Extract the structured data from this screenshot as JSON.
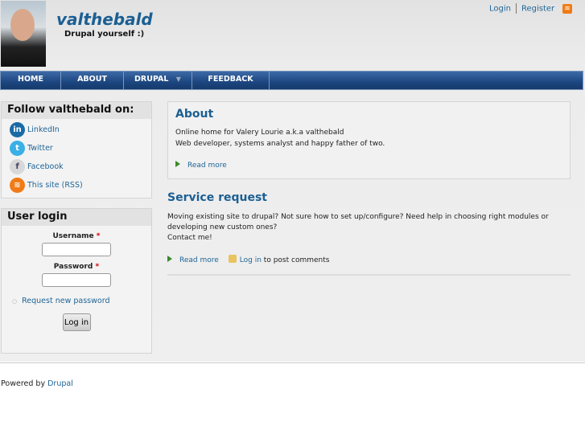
{
  "header": {
    "site_name": "valthebald",
    "slogan": "Drupal yourself :)",
    "login": "Login",
    "register": "Register"
  },
  "nav": [
    {
      "label": "HOME"
    },
    {
      "label": "ABOUT"
    },
    {
      "label": "DRUPAL"
    },
    {
      "label": "FEEDBACK"
    }
  ],
  "follow": {
    "title": "Follow valthebald on:",
    "items": [
      {
        "label": "LinkedIn",
        "icon": "linkedin-icon",
        "glyph": "in",
        "color": "#1a6aa6"
      },
      {
        "label": "Twitter",
        "icon": "twitter-icon",
        "glyph": "t",
        "color": "#3ab0e6"
      },
      {
        "label": "Facebook",
        "icon": "facebook-icon",
        "glyph": "f",
        "color": "#d8d8d8"
      },
      {
        "label": "This site (RSS)",
        "icon": "rss-icon",
        "glyph": "≋",
        "color": "#f07b16"
      }
    ]
  },
  "login": {
    "title": "User login",
    "username_label": "Username",
    "password_label": "Password",
    "required": "*",
    "request_password": "Request new password",
    "button": "Log in"
  },
  "about": {
    "title": "About",
    "line1": "Online home for Valery Lourie a.k.a valthebald",
    "line2": "Web developer, systems analyst and happy father of two.",
    "read_more": "Read more"
  },
  "service": {
    "title": "Service request",
    "line1": "Moving existing site to drupal? Not sure how to set up/configure? Need help in choosing right modules or developing new custom ones?",
    "line2": "Contact me!",
    "read_more": "Read more",
    "login": "Log in",
    "post_comments": " to post comments"
  },
  "footer": {
    "powered": "Powered by ",
    "drupal": "Drupal"
  }
}
